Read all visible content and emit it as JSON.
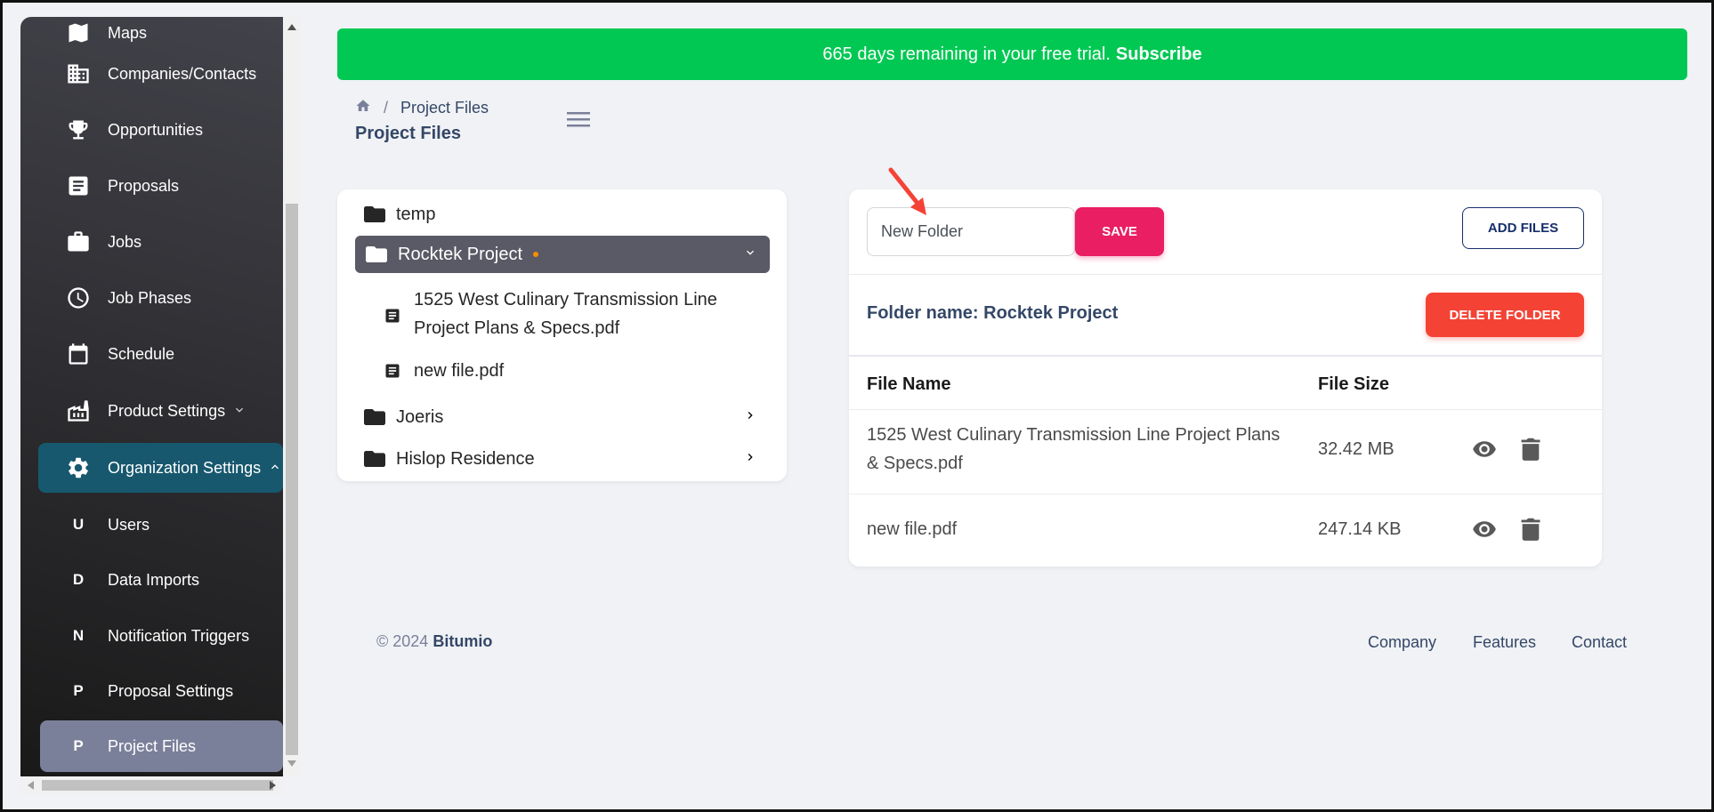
{
  "sidebar": {
    "items": [
      {
        "label": "Maps",
        "icon": "map-icon"
      },
      {
        "label": "Companies/Contacts",
        "icon": "building-icon"
      },
      {
        "label": "Opportunities",
        "icon": "trophy-icon"
      },
      {
        "label": "Proposals",
        "icon": "document-icon"
      },
      {
        "label": "Jobs",
        "icon": "briefcase-icon"
      },
      {
        "label": "Job Phases",
        "icon": "clock-icon"
      },
      {
        "label": "Schedule",
        "icon": "calendar-icon"
      },
      {
        "label": "Product Settings",
        "icon": "factory-icon"
      },
      {
        "label": "Organization Settings",
        "icon": "gear-icon"
      }
    ],
    "sub_items": [
      {
        "letter": "U",
        "label": "Users"
      },
      {
        "letter": "D",
        "label": "Data Imports"
      },
      {
        "letter": "N",
        "label": "Notification Triggers"
      },
      {
        "letter": "P",
        "label": "Proposal Settings"
      },
      {
        "letter": "P",
        "label": "Project Files"
      }
    ]
  },
  "banner": {
    "text": "665 days remaining in your free trial.",
    "link": "Subscribe",
    "color": "#00c853"
  },
  "breadcrumb": {
    "current": "Project Files",
    "title": "Project Files"
  },
  "tree": {
    "folders": [
      {
        "name": "temp"
      },
      {
        "name": "Rocktek Project",
        "files": [
          "1525 West Culinary Transmission Line",
          "Project Plans & Specs.pdf",
          "new file.pdf"
        ]
      },
      {
        "name": "Joeris"
      },
      {
        "name": "Hislop Residence"
      }
    ]
  },
  "files_panel": {
    "input_value": "New Folder",
    "save_label": "SAVE",
    "add_files_label": "ADD FILES",
    "folder_label": "Folder name: Rocktek Project",
    "delete_label": "DELETE FOLDER",
    "columns": [
      "File Name",
      "File Size"
    ],
    "rows": [
      {
        "name_line1": "1525 West Culinary Transmission Line Project Plans",
        "name_line2": "& Specs.pdf",
        "size": "32.42 MB"
      },
      {
        "name_line1": "new file.pdf",
        "name_line2": "",
        "size": "247.14 KB"
      }
    ]
  },
  "footer": {
    "copyright": "© 2024",
    "brand": "Bitumio",
    "links": [
      "Company",
      "Features",
      "Contact"
    ]
  },
  "colors": {
    "accent_pink": "#e91e63",
    "danger": "#f44335",
    "sidebar_active": "#17586e",
    "annotation_arrow": "#f44336"
  }
}
